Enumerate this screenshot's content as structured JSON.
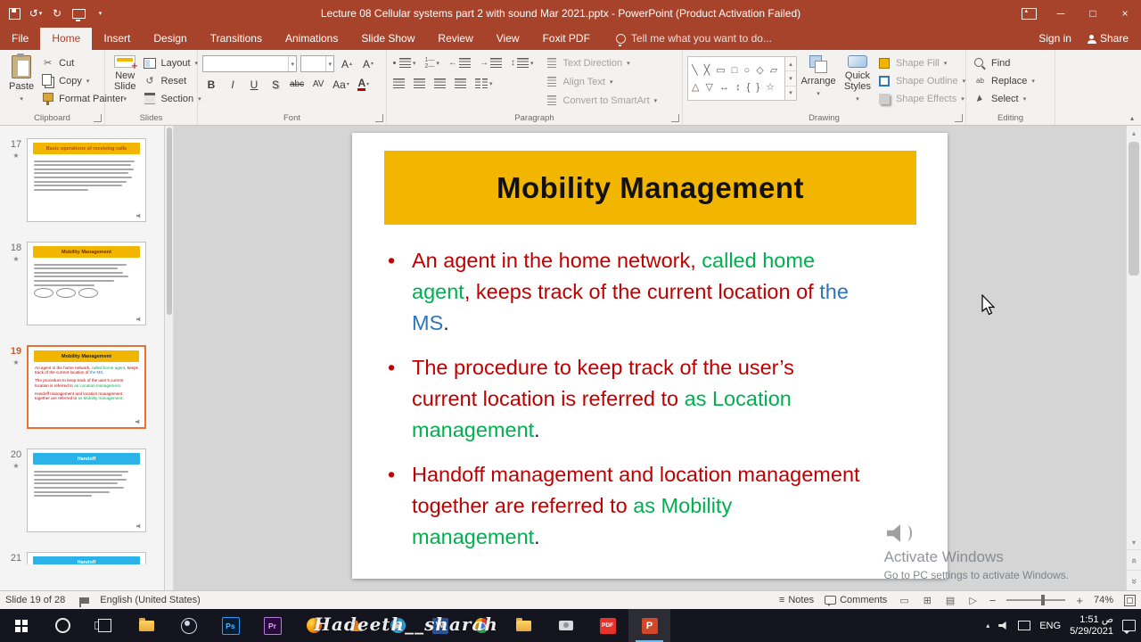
{
  "colors": {
    "brand": "#a8432b",
    "slide_title_bg": "#f2b600",
    "red": "#c00000",
    "green": "#00b050",
    "blue": "#2e75b6",
    "thumb_selection": "#e96f33"
  },
  "icons": {
    "undo": "↺",
    "redo": "↻",
    "dropdown": "▾",
    "up": "▴",
    "down": "▾",
    "cut": "✂",
    "minimize": "─",
    "maximize": "□",
    "close": "×",
    "collapse_ribbon": "▴",
    "chevrons_left": "«",
    "chevrons_right": "»",
    "grow_font": "A",
    "shrink_font": "A",
    "spacing_arrows": "↕",
    "view_normal": "▭",
    "view_sorter": "⊞",
    "view_reading": "▤",
    "view_show": "▷",
    "notes": "≡"
  },
  "window": {
    "title": "Lecture 08 Cellular systems part 2  with sound Mar 2021.pptx - PowerPoint (Product Activation Failed)"
  },
  "ribbon_tabs": [
    {
      "label": "File"
    },
    {
      "label": "Home",
      "active": true
    },
    {
      "label": "Insert"
    },
    {
      "label": "Design"
    },
    {
      "label": "Transitions"
    },
    {
      "label": "Animations"
    },
    {
      "label": "Slide Show"
    },
    {
      "label": "Review"
    },
    {
      "label": "View"
    },
    {
      "label": "Foxit PDF"
    }
  ],
  "tellme": {
    "label": "Tell me what you want to do..."
  },
  "account": {
    "sign_in": "Sign in",
    "share": "Share"
  },
  "ribbon": {
    "clipboard": {
      "label": "Clipboard",
      "paste": "Paste",
      "cut": "Cut",
      "copy": "Copy",
      "format_painter": "Format Painter"
    },
    "slides": {
      "label": "Slides",
      "new_slide": "New Slide",
      "layout": "Layout",
      "reset": "Reset",
      "section": "Section"
    },
    "font": {
      "label": "Font",
      "bold": "B",
      "italic": "I",
      "underline": "U",
      "shadow": "S",
      "strike": "abc",
      "spacing": "AV",
      "case": "Aa",
      "color": "A"
    },
    "paragraph": {
      "label": "Paragraph",
      "text_direction": "Text Direction",
      "align_text": "Align Text",
      "smartart": "Convert to SmartArt"
    },
    "drawing": {
      "label": "Drawing",
      "arrange": "Arrange",
      "quick_styles": "Quick Styles",
      "shape_fill": "Shape Fill",
      "shape_outline": "Shape Outline",
      "shape_effects": "Shape Effects",
      "shapes_row1": "╲ ╳ ▭ □ ○ ◇ ▱",
      "shapes_row2": "△ ▽ ↔ ↕ { } ☆"
    },
    "editing": {
      "label": "Editing",
      "find": "Find",
      "replace": "Replace",
      "select": "Select"
    }
  },
  "slide": {
    "title": "Mobility Management",
    "bullet_char": "•",
    "bullets": [
      {
        "segments": [
          {
            "text": "An agent in the home network, ",
            "color": "red"
          },
          {
            "text": "called home agent",
            "color": "green"
          },
          {
            "text": ", keeps track of the current location of ",
            "color": "red"
          },
          {
            "text": "the MS",
            "color": "blue"
          },
          {
            "text": ".",
            "color": "black"
          }
        ]
      },
      {
        "segments": [
          {
            "text": "The procedure to keep track of the user’s current location is referred to ",
            "color": "red"
          },
          {
            "text": "as Location management",
            "color": "green"
          },
          {
            "text": ".",
            "color": "black"
          }
        ]
      },
      {
        "segments": [
          {
            "text": "Handoff management and location management together are referred to ",
            "color": "red"
          },
          {
            "text": "as Mobility management",
            "color": "green"
          },
          {
            "text": ".",
            "color": "black"
          }
        ]
      }
    ]
  },
  "thumbnails": [
    {
      "num": "17",
      "star": true,
      "selected": false,
      "title": "Basic operations of receiving calls",
      "banner_bg": "#f2b600",
      "title_color": "#b84a00",
      "body": [
        96,
        92,
        95,
        90,
        93,
        88,
        84,
        52
      ],
      "diagram": false,
      "partial": false
    },
    {
      "num": "18",
      "star": true,
      "selected": false,
      "title": "Mobility Management",
      "banner_bg": "#f2b600",
      "title_color": "#6b2c00",
      "body": [
        88,
        80,
        85,
        90,
        76,
        58
      ],
      "diagram": true,
      "partial": false
    },
    {
      "num": "19",
      "star": true,
      "selected": true,
      "title": "Mobility Management",
      "banner_bg": "#f2b600",
      "title_color": "#222222",
      "body": "mini",
      "diagram": false,
      "partial": false
    },
    {
      "num": "20",
      "star": true,
      "selected": false,
      "title": "Handoff",
      "banner_bg": "#2bb2e8",
      "title_color": "#ffffff",
      "body": [
        90,
        84,
        88,
        80,
        86,
        72,
        55
      ],
      "diagram": false,
      "partial": false
    },
    {
      "num": "21",
      "star": false,
      "selected": false,
      "title": "Handoff",
      "banner_bg": "#2bb2e8",
      "title_color": "#ffffff",
      "body": [],
      "diagram": false,
      "partial": true
    }
  ],
  "watermark": {
    "line1": "Activate Windows",
    "line2": "Go to PC settings to activate Windows."
  },
  "statusbar": {
    "slide_indicator": "Slide 19 of 28",
    "language": "English (United States)",
    "notes": "Notes",
    "comments": "Comments",
    "zoom": "74%",
    "zoom_out": "−",
    "zoom_in": "+"
  },
  "taskbar": {
    "watermark": "Hadeeth__sharah",
    "lang": "ENG",
    "time": "1:51 ص",
    "date": "5/29/2021",
    "icons": [
      {
        "name": "start"
      },
      {
        "name": "search"
      },
      {
        "name": "task-view"
      },
      {
        "name": "file-explorer"
      },
      {
        "name": "obs"
      },
      {
        "name": "photoshop",
        "text": "Ps"
      },
      {
        "name": "premiere",
        "text": "Pr"
      },
      {
        "name": "firefox"
      },
      {
        "name": "vlc"
      },
      {
        "name": "telegram"
      },
      {
        "name": "word",
        "text": "W"
      },
      {
        "name": "chrome"
      },
      {
        "name": "folder"
      },
      {
        "name": "camera"
      },
      {
        "name": "pdf",
        "text": "PDF"
      },
      {
        "name": "powerpoint",
        "text": "P",
        "active": true
      }
    ]
  }
}
